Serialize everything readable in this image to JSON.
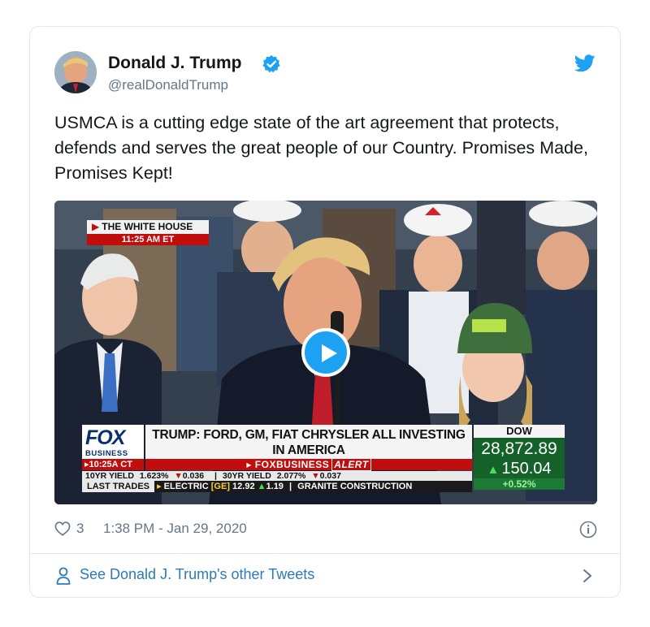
{
  "tweet": {
    "display_name": "Donald J. Trump",
    "handle": "@realDonaldTrump",
    "text": "USMCA is a cutting edge state of the art agreement that protects, defends and serves the great people of our Country. Promises Made, Promises Kept!",
    "likes": "3",
    "timestamp": "1:38 PM - Jan 29, 2020",
    "footer_link": "See Donald J. Trump's other Tweets"
  },
  "video_overlay": {
    "location_label": "THE WHITE HOUSE",
    "location_time": "11:25 AM ET",
    "network": "FOX",
    "network_sub": "BUSINESS",
    "broadcast_time": "10:25A CT",
    "headline": "TRUMP: FORD, GM, FIAT CHRYSLER ALL INVESTING IN AMERICA",
    "alert_brand": "FOXBUSINESS",
    "alert_word": "ALERT",
    "dow_label": "DOW",
    "dow_value": "28,872.89",
    "dow_change": "150.04",
    "dow_pct": "+0.52%",
    "ticker_10yr_label": "10YR YIELD",
    "ticker_10yr_value": "1.623%",
    "ticker_10yr_change": "0.036",
    "ticker_30yr_label": "30YR YIELD",
    "ticker_30yr_value": "2.077%",
    "ticker_30yr_change": "0.037",
    "last_trades_label": "LAST TRADES",
    "trade1_name": "ELECTRIC",
    "trade1_symbol": "GE",
    "trade1_price": "12.92",
    "trade1_change": "1.19",
    "trade2_name": "GRANITE CONSTRUCTION"
  },
  "colors": {
    "link_blue": "#1da1f2",
    "footer_link": "#2b7bb9",
    "secondary_text": "#657786",
    "fox_red": "#c20d0d",
    "dow_green": "#14622a"
  },
  "icons": [
    "verified-badge-icon",
    "twitter-bird-icon",
    "play-icon",
    "heart-icon",
    "info-icon",
    "person-icon",
    "chevron-right-icon"
  ]
}
